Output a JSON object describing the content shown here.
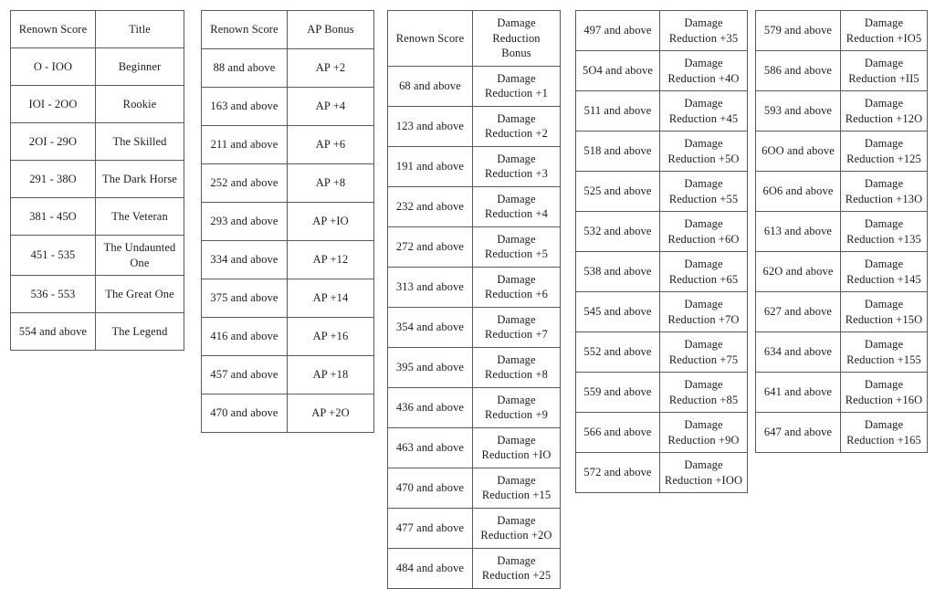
{
  "page": {
    "background_color": "#ffffff",
    "border_color": "#5a5a5a",
    "text_color": "#1c1c1c"
  },
  "tables": [
    {
      "id": "renown-title",
      "name": "renown-score-title-table",
      "headers": [
        "Renown Score",
        "Title"
      ],
      "rows": [
        [
          "O - IOO",
          "Beginner"
        ],
        [
          "IOI - 2OO",
          "Rookie"
        ],
        [
          "2OI - 29O",
          "The Skilled"
        ],
        [
          "291 - 38O",
          "The Dark Horse"
        ],
        [
          "381 - 45O",
          "The Veteran"
        ],
        [
          "451 - 535",
          "The Undaunted One"
        ],
        [
          "536 - 553",
          "The Great One"
        ],
        [
          "554 and above",
          "The Legend"
        ]
      ]
    },
    {
      "id": "ap-bonus",
      "name": "renown-score-ap-bonus-table",
      "headers": [
        "Renown Score",
        "AP Bonus"
      ],
      "rows": [
        [
          "88 and above",
          "AP +2"
        ],
        [
          "163 and above",
          "AP +4"
        ],
        [
          "211 and above",
          "AP +6"
        ],
        [
          "252 and above",
          "AP +8"
        ],
        [
          "293 and above",
          "AP +IO"
        ],
        [
          "334 and above",
          "AP +12"
        ],
        [
          "375 and above",
          "AP +14"
        ],
        [
          "416 and above",
          "AP +16"
        ],
        [
          "457 and above",
          "AP +18"
        ],
        [
          "470 and above",
          "AP +2O"
        ]
      ]
    },
    {
      "id": "dr-bonus-1",
      "name": "damage-reduction-bonus-table-part-1",
      "headers": [
        "Renown Score",
        "Damage Reduction Bonus"
      ],
      "rows": [
        [
          "68 and above",
          "Damage Reduction +1"
        ],
        [
          "123 and above",
          "Damage Reduction +2"
        ],
        [
          "191 and above",
          "Damage Reduction +3"
        ],
        [
          "232 and above",
          "Damage Reduction +4"
        ],
        [
          "272 and above",
          "Damage Reduction +5"
        ],
        [
          "313 and above",
          "Damage Reduction +6"
        ],
        [
          "354 and above",
          "Damage Reduction +7"
        ],
        [
          "395 and above",
          "Damage Reduction +8"
        ],
        [
          "436 and above",
          "Damage Reduction +9"
        ],
        [
          "463 and above",
          "Damage Reduction +IO"
        ],
        [
          "470 and above",
          "Damage Reduction +15"
        ],
        [
          "477 and above",
          "Damage Reduction +2O"
        ],
        [
          "484 and above",
          "Damage Reduction +25"
        ]
      ]
    },
    {
      "id": "dr-bonus-2",
      "name": "damage-reduction-bonus-table-part-2",
      "headers": null,
      "rows": [
        [
          "497 and above",
          "Damage Reduction +35"
        ],
        [
          "5O4 and above",
          "Damage Reduction +4O"
        ],
        [
          "511 and above",
          "Damage Reduction +45"
        ],
        [
          "518 and above",
          "Damage Reduction +5O"
        ],
        [
          "525 and above",
          "Damage Reduction +55"
        ],
        [
          "532 and above",
          "Damage Reduction +6O"
        ],
        [
          "538 and above",
          "Damage Reduction +65"
        ],
        [
          "545 and above",
          "Damage Reduction +7O"
        ],
        [
          "552 and above",
          "Damage Reduction +75"
        ],
        [
          "559 and above",
          "Damage Reduction +85"
        ],
        [
          "566 and above",
          "Damage Reduction +9O"
        ],
        [
          "572 and above",
          "Damage Reduction +IOO"
        ]
      ]
    },
    {
      "id": "dr-bonus-3",
      "name": "damage-reduction-bonus-table-part-3",
      "headers": null,
      "rows": [
        [
          "579 and above",
          "Damage Reduction +IO5"
        ],
        [
          "586 and above",
          "Damage Reduction +II5"
        ],
        [
          "593 and above",
          "Damage Reduction +12O"
        ],
        [
          "6OO and above",
          "Damage Reduction +125"
        ],
        [
          "6O6 and above",
          "Damage Reduction +13O"
        ],
        [
          "613 and above",
          "Damage Reduction +135"
        ],
        [
          "62O and above",
          "Damage Reduction +145"
        ],
        [
          "627 and above",
          "Damage Reduction +15O"
        ],
        [
          "634 and above",
          "Damage Reduction +155"
        ],
        [
          "641 and above",
          "Damage Reduction +16O"
        ],
        [
          "647 and above",
          "Damage Reduction +165"
        ]
      ]
    }
  ]
}
